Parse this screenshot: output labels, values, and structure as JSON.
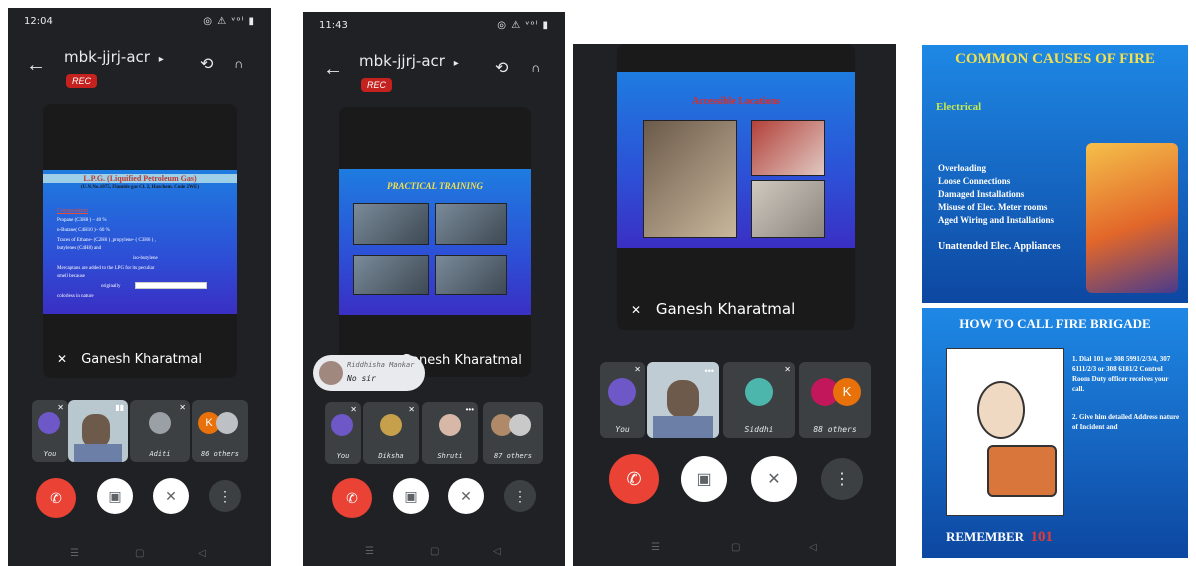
{
  "panel1": {
    "time": "12:04",
    "status_icons": "◎ ⚠ ᵛᵒˡ ▮",
    "meeting_code": "mbk-jjrj-acr",
    "rec": "REC",
    "slide": {
      "title": "L.P.G. (Liquified Petroleum Gas)",
      "subtitle": "(U.N.No.1075, Flamble gas Cl. 2, Hazchem. Code 2WE)",
      "composition_heading": "Composition",
      "lines": [
        "Propane (C3H8 ) – 40 %",
        "n-Butane( C4H10 )– 60 %",
        "Traces of Ethane- (C2H6 ) ,propylene- ( C3H6 ) ,",
        "butylenes (C4H8) and",
        "iso-butylene",
        "Mercaptans are added to the LPG for its peculiar",
        "smell because",
        "originally",
        "colorless in nature"
      ]
    },
    "speaker": "Ganesh Kharatmal",
    "participants": [
      "You",
      "",
      "Aditi",
      "86 others"
    ],
    "others_initial": "K"
  },
  "panel2": {
    "time": "11:43",
    "status_icons": "◎ ⚠ ᵛᵒˡ ▮",
    "meeting_code": "mbk-jjrj-acr",
    "rec": "REC",
    "slide_title": "PRACTICAL TRAINING",
    "speaker": "Ganesh Kharatmal",
    "chat_name": "Riddhisha Mankar",
    "chat_msg": "No sir",
    "participants": [
      "You",
      "Diksha",
      "Shruti",
      "87 others"
    ]
  },
  "panel3": {
    "slide_title": "Accessible Locations",
    "speaker": "Ganesh Kharatmal",
    "participants": [
      "You",
      "",
      "Siddhi",
      "88 others"
    ],
    "others_initial": "K"
  },
  "slide4a": {
    "title": "COMMON CAUSES OF FIRE",
    "category": "Electrical",
    "items": [
      "Overloading",
      "Loose Connections",
      "Damaged Installations",
      "Misuse of Elec. Meter rooms",
      "Aged Wiring and Installations"
    ],
    "last_item": "Unattended Elec. Appliances"
  },
  "slide4b": {
    "title": "HOW TO CALL FIRE BRIGADE",
    "step1": "1. Dial 101 or 308 5991/2/3/4, 307 6111/2/3 or 308 6181/2 Control Room Duty officer receives your call.",
    "step2": "2. Give him detailed Address nature of Incident and",
    "remember": "REMEMBER",
    "number": "101"
  },
  "icons": {
    "back": "←",
    "dropdown": "▸",
    "flip_camera": "⟲",
    "audio": "🎧",
    "mic_off": "🎙",
    "end_call": "✆",
    "camera_off": "▣",
    "more": "⋮",
    "nav_menu": "☰",
    "nav_home": "▢",
    "nav_back": "◁"
  }
}
